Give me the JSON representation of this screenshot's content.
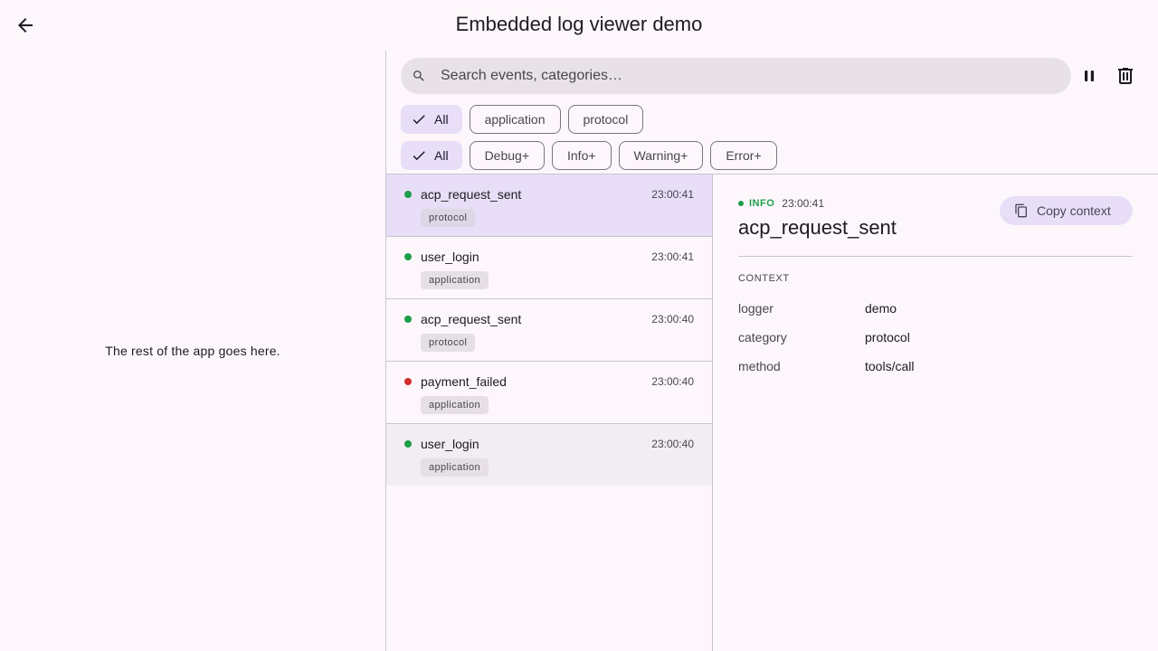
{
  "app_title": "Embedded log viewer demo",
  "left_placeholder": "The rest of the app goes here.",
  "search": {
    "placeholder": "Search events, categories…",
    "value": ""
  },
  "toolbar": {
    "pause_icon": "pause-icon",
    "clear_icon": "delete-icon"
  },
  "category_filters": [
    {
      "label": "All",
      "selected": true
    },
    {
      "label": "application",
      "selected": false
    },
    {
      "label": "protocol",
      "selected": false
    }
  ],
  "level_filters": [
    {
      "label": "All",
      "selected": true
    },
    {
      "label": "Debug+",
      "selected": false
    },
    {
      "label": "Info+",
      "selected": false
    },
    {
      "label": "Warning+",
      "selected": false
    },
    {
      "label": "Error+",
      "selected": false
    }
  ],
  "colors": {
    "info": "#1e9e4a",
    "error": "#d32f2f",
    "selected_bg": "#e8def8"
  },
  "events": [
    {
      "event": "acp_request_sent",
      "time": "23:00:41",
      "category": "protocol",
      "level": "info"
    },
    {
      "event": "user_login",
      "time": "23:00:41",
      "category": "application",
      "level": "info"
    },
    {
      "event": "acp_request_sent",
      "time": "23:00:40",
      "category": "protocol",
      "level": "info"
    },
    {
      "event": "payment_failed",
      "time": "23:00:40",
      "category": "application",
      "level": "error"
    },
    {
      "event": "user_login",
      "time": "23:00:40",
      "category": "application",
      "level": "info"
    }
  ],
  "detail": {
    "level": "INFO",
    "time": "23:00:41",
    "title": "acp_request_sent",
    "copy_label": "Copy context",
    "context_label": "CONTEXT",
    "context": [
      {
        "key": "logger",
        "value": "demo"
      },
      {
        "key": "category",
        "value": "protocol"
      },
      {
        "key": "method",
        "value": "tools/call"
      }
    ]
  }
}
